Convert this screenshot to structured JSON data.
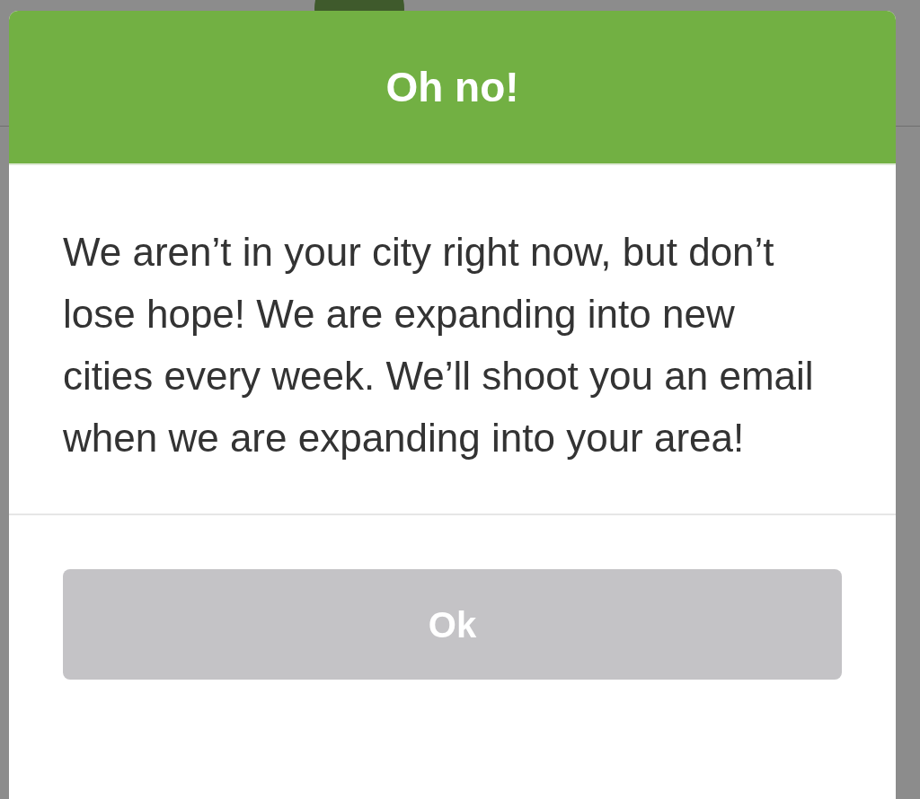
{
  "dialog": {
    "title": "Oh no!",
    "message": "We aren’t in your city right now, but don’t lose hope! We are expanding into new cities every week. We’ll shoot you an email when we are expanding into your area!",
    "button": "Ok"
  }
}
